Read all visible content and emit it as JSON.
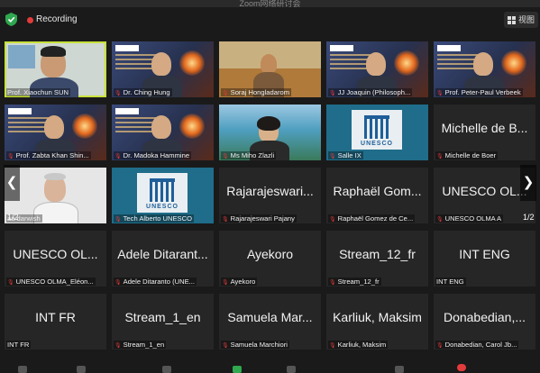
{
  "window": {
    "title": "Zoom网络研讨会"
  },
  "recording": {
    "label": "Recording",
    "color": "#e23b3b"
  },
  "view_button": {
    "label": "视图"
  },
  "pager": {
    "left_label": "1/2",
    "right_label": "1/2"
  },
  "active_speaker_color": "#c8e13a",
  "tiles": [
    {
      "name": "Prof. Xiaochun SUN",
      "display": "",
      "type": "video-active",
      "mic_muted": false
    },
    {
      "name": "Dr. Ching Hung",
      "display": "",
      "type": "video-slide",
      "mic_muted": true
    },
    {
      "name": "Soraj Hongladarom",
      "display": "",
      "type": "video-outdoor",
      "mic_muted": true
    },
    {
      "name": "JJ Joaquin (Philosoph...",
      "display": "",
      "type": "video-slide",
      "mic_muted": true
    },
    {
      "name": "Prof. Peter-Paul Verbeek",
      "display": "",
      "type": "video-slide",
      "mic_muted": true
    },
    {
      "name": "Prof. Zabta Khan Shin...",
      "display": "",
      "type": "video-slide",
      "mic_muted": true
    },
    {
      "name": "Dr. Madoka Hammine",
      "display": "",
      "type": "video-slide",
      "mic_muted": true
    },
    {
      "name": "Ms Miho Zlazli",
      "display": "",
      "type": "video-beach",
      "mic_muted": true
    },
    {
      "name": "Salle IX",
      "display": "",
      "type": "logo",
      "mic_muted": true
    },
    {
      "name": "Michelle de Boer",
      "display": "Michelle de B...",
      "type": "text",
      "mic_muted": true
    },
    {
      "name": "aa darwish",
      "display": "",
      "type": "video-white",
      "mic_muted": false
    },
    {
      "name": "Tech Alberto UNESCO",
      "display": "",
      "type": "logo",
      "mic_muted": true
    },
    {
      "name": "Rajarajeswari Pajany",
      "display": "Rajarajeswari...",
      "type": "text",
      "mic_muted": true
    },
    {
      "name": "Raphaël Gomez de Ce...",
      "display": "Raphaël Gom...",
      "type": "text",
      "mic_muted": true
    },
    {
      "name": "UNESCO OLMA A",
      "display": "UNESCO OL...",
      "type": "text",
      "mic_muted": true
    },
    {
      "name": "UNESCO OLMA_Eléon...",
      "display": "UNESCO OL...",
      "type": "text",
      "mic_muted": true
    },
    {
      "name": "Adele Ditaranto (UNE...",
      "display": "Adele Ditarant...",
      "type": "text",
      "mic_muted": true
    },
    {
      "name": "Ayekoro",
      "display": "Ayekoro",
      "type": "text",
      "mic_muted": true
    },
    {
      "name": "Stream_12_fr",
      "display": "Stream_12_fr",
      "type": "text",
      "mic_muted": true
    },
    {
      "name": "INT ENG",
      "display": "INT ENG",
      "type": "text",
      "mic_muted": false
    },
    {
      "name": "INT FR",
      "display": "INT FR",
      "type": "text",
      "mic_muted": false
    },
    {
      "name": "Stream_1_en",
      "display": "Stream_1_en",
      "type": "text",
      "mic_muted": true
    },
    {
      "name": "Samuela Marchiori",
      "display": "Samuela Mar...",
      "type": "text",
      "mic_muted": true
    },
    {
      "name": "Karliuk, Maksim",
      "display": "Karliuk, Maksim",
      "type": "text",
      "mic_muted": true
    },
    {
      "name": "Donabedian, Carol Jb...",
      "display": "Donabedian,...",
      "type": "text",
      "mic_muted": true
    }
  ],
  "logo_text": "UNESCO"
}
